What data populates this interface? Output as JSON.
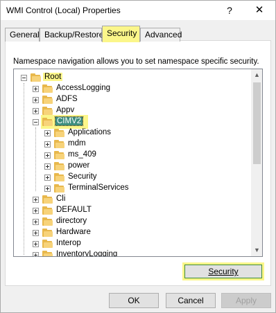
{
  "window": {
    "title": "WMI Control (Local) Properties",
    "help_glyph": "?",
    "close_glyph": "✕"
  },
  "tabs": [
    {
      "label": "General"
    },
    {
      "label": "Backup/Restore"
    },
    {
      "label": "Security",
      "active": true
    },
    {
      "label": "Advanced"
    }
  ],
  "description": "Namespace navigation allows you to set namespace specific security.",
  "tree": {
    "root": "Root",
    "level1": [
      "AccessLogging",
      "ADFS",
      "Appv",
      "CIMV2",
      "Cli",
      "DEFAULT",
      "directory",
      "Hardware",
      "Interop",
      "InventoryLogging"
    ],
    "cimv2_children": [
      "Applications",
      "mdm",
      "ms_409",
      "power",
      "Security",
      "TerminalServices"
    ],
    "selected": "CIMV2"
  },
  "scrollbar": {
    "up": "▲",
    "down": "▼"
  },
  "security_button": "Security",
  "buttons": {
    "ok": "OK",
    "cancel": "Cancel",
    "apply": "Apply"
  },
  "colors": {
    "highlight": "#fbf68a",
    "selection": "#3d8e7f",
    "folder": "#e8b84c"
  }
}
